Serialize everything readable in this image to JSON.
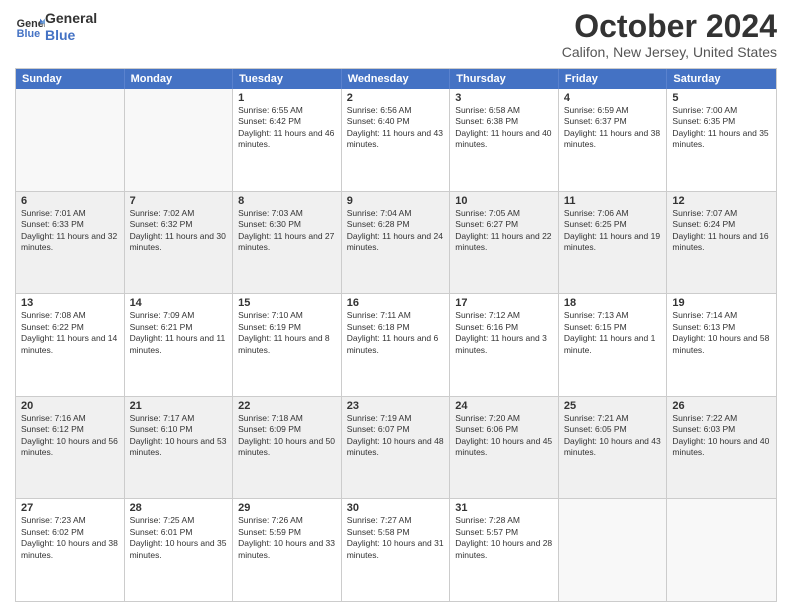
{
  "logo": {
    "line1": "General",
    "line2": "Blue"
  },
  "title": "October 2024",
  "subtitle": "Califon, New Jersey, United States",
  "header_days": [
    "Sunday",
    "Monday",
    "Tuesday",
    "Wednesday",
    "Thursday",
    "Friday",
    "Saturday"
  ],
  "rows": [
    [
      {
        "day": "",
        "text": ""
      },
      {
        "day": "",
        "text": ""
      },
      {
        "day": "1",
        "text": "Sunrise: 6:55 AM\nSunset: 6:42 PM\nDaylight: 11 hours and 46 minutes."
      },
      {
        "day": "2",
        "text": "Sunrise: 6:56 AM\nSunset: 6:40 PM\nDaylight: 11 hours and 43 minutes."
      },
      {
        "day": "3",
        "text": "Sunrise: 6:58 AM\nSunset: 6:38 PM\nDaylight: 11 hours and 40 minutes."
      },
      {
        "day": "4",
        "text": "Sunrise: 6:59 AM\nSunset: 6:37 PM\nDaylight: 11 hours and 38 minutes."
      },
      {
        "day": "5",
        "text": "Sunrise: 7:00 AM\nSunset: 6:35 PM\nDaylight: 11 hours and 35 minutes."
      }
    ],
    [
      {
        "day": "6",
        "text": "Sunrise: 7:01 AM\nSunset: 6:33 PM\nDaylight: 11 hours and 32 minutes."
      },
      {
        "day": "7",
        "text": "Sunrise: 7:02 AM\nSunset: 6:32 PM\nDaylight: 11 hours and 30 minutes."
      },
      {
        "day": "8",
        "text": "Sunrise: 7:03 AM\nSunset: 6:30 PM\nDaylight: 11 hours and 27 minutes."
      },
      {
        "day": "9",
        "text": "Sunrise: 7:04 AM\nSunset: 6:28 PM\nDaylight: 11 hours and 24 minutes."
      },
      {
        "day": "10",
        "text": "Sunrise: 7:05 AM\nSunset: 6:27 PM\nDaylight: 11 hours and 22 minutes."
      },
      {
        "day": "11",
        "text": "Sunrise: 7:06 AM\nSunset: 6:25 PM\nDaylight: 11 hours and 19 minutes."
      },
      {
        "day": "12",
        "text": "Sunrise: 7:07 AM\nSunset: 6:24 PM\nDaylight: 11 hours and 16 minutes."
      }
    ],
    [
      {
        "day": "13",
        "text": "Sunrise: 7:08 AM\nSunset: 6:22 PM\nDaylight: 11 hours and 14 minutes."
      },
      {
        "day": "14",
        "text": "Sunrise: 7:09 AM\nSunset: 6:21 PM\nDaylight: 11 hours and 11 minutes."
      },
      {
        "day": "15",
        "text": "Sunrise: 7:10 AM\nSunset: 6:19 PM\nDaylight: 11 hours and 8 minutes."
      },
      {
        "day": "16",
        "text": "Sunrise: 7:11 AM\nSunset: 6:18 PM\nDaylight: 11 hours and 6 minutes."
      },
      {
        "day": "17",
        "text": "Sunrise: 7:12 AM\nSunset: 6:16 PM\nDaylight: 11 hours and 3 minutes."
      },
      {
        "day": "18",
        "text": "Sunrise: 7:13 AM\nSunset: 6:15 PM\nDaylight: 11 hours and 1 minute."
      },
      {
        "day": "19",
        "text": "Sunrise: 7:14 AM\nSunset: 6:13 PM\nDaylight: 10 hours and 58 minutes."
      }
    ],
    [
      {
        "day": "20",
        "text": "Sunrise: 7:16 AM\nSunset: 6:12 PM\nDaylight: 10 hours and 56 minutes."
      },
      {
        "day": "21",
        "text": "Sunrise: 7:17 AM\nSunset: 6:10 PM\nDaylight: 10 hours and 53 minutes."
      },
      {
        "day": "22",
        "text": "Sunrise: 7:18 AM\nSunset: 6:09 PM\nDaylight: 10 hours and 50 minutes."
      },
      {
        "day": "23",
        "text": "Sunrise: 7:19 AM\nSunset: 6:07 PM\nDaylight: 10 hours and 48 minutes."
      },
      {
        "day": "24",
        "text": "Sunrise: 7:20 AM\nSunset: 6:06 PM\nDaylight: 10 hours and 45 minutes."
      },
      {
        "day": "25",
        "text": "Sunrise: 7:21 AM\nSunset: 6:05 PM\nDaylight: 10 hours and 43 minutes."
      },
      {
        "day": "26",
        "text": "Sunrise: 7:22 AM\nSunset: 6:03 PM\nDaylight: 10 hours and 40 minutes."
      }
    ],
    [
      {
        "day": "27",
        "text": "Sunrise: 7:23 AM\nSunset: 6:02 PM\nDaylight: 10 hours and 38 minutes."
      },
      {
        "day": "28",
        "text": "Sunrise: 7:25 AM\nSunset: 6:01 PM\nDaylight: 10 hours and 35 minutes."
      },
      {
        "day": "29",
        "text": "Sunrise: 7:26 AM\nSunset: 5:59 PM\nDaylight: 10 hours and 33 minutes."
      },
      {
        "day": "30",
        "text": "Sunrise: 7:27 AM\nSunset: 5:58 PM\nDaylight: 10 hours and 31 minutes."
      },
      {
        "day": "31",
        "text": "Sunrise: 7:28 AM\nSunset: 5:57 PM\nDaylight: 10 hours and 28 minutes."
      },
      {
        "day": "",
        "text": ""
      },
      {
        "day": "",
        "text": ""
      }
    ]
  ]
}
